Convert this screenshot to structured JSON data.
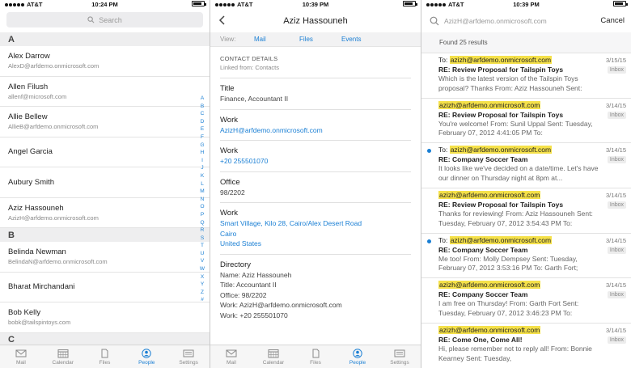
{
  "panel1": {
    "status": {
      "carrier": "AT&T",
      "time": "10:24 PM"
    },
    "search_placeholder": "Search",
    "sections": [
      {
        "letter": "A",
        "contacts": [
          {
            "name": "Alex Darrow",
            "email": "AlexD@arfdemo.onmicrosoft.com"
          },
          {
            "name": "Allen Filush",
            "email": "allenf@microsoft.com"
          },
          {
            "name": "Allie Bellew",
            "email": "AllieB@arfdemo.onmicrosoft.com"
          },
          {
            "name": "Angel Garcia",
            "email": ""
          },
          {
            "name": "Aubury Smith",
            "email": ""
          },
          {
            "name": "Aziz Hassouneh",
            "email": "AzizH@arfdemo.onmicrosoft.com"
          }
        ]
      },
      {
        "letter": "B",
        "contacts": [
          {
            "name": "Belinda Newman",
            "email": "BelindaN@arfdemo.onmicrosoft.com"
          },
          {
            "name": "Bharat Mirchandani",
            "email": ""
          },
          {
            "name": "Bob Kelly",
            "email": "bobk@tailspintoys.com"
          }
        ]
      },
      {
        "letter": "C",
        "contacts": []
      }
    ],
    "index_letters": [
      "A",
      "B",
      "C",
      "D",
      "E",
      "F",
      "G",
      "H",
      "I",
      "J",
      "K",
      "L",
      "M",
      "N",
      "O",
      "P",
      "Q",
      "R",
      "S",
      "T",
      "U",
      "V",
      "W",
      "X",
      "Y",
      "Z",
      "#"
    ],
    "active_tab": 3
  },
  "panel2": {
    "status": {
      "carrier": "AT&T",
      "time": "10:39 PM"
    },
    "title": "Aziz Hassouneh",
    "view_label": "View:",
    "view_links": [
      "Mail",
      "Files",
      "Events"
    ],
    "section_title": "CONTACT DETAILS",
    "section_sub": "Linked from: Contacts",
    "fields": {
      "title": {
        "label": "Title",
        "value": "Finance, Accountant II"
      },
      "work_email": {
        "label": "Work",
        "value": "AzizH@arfdemo.onmicrosoft.com"
      },
      "work_phone": {
        "label": "Work",
        "value": "+20 255501070"
      },
      "office": {
        "label": "Office",
        "value": "98/2202"
      },
      "work_address": {
        "label": "Work",
        "lines": [
          "Smart Village, Kilo 28, Cairo/Alex Desert Road",
          "Cairo",
          "United States"
        ]
      },
      "directory": {
        "label": "Directory",
        "lines": [
          "Name: Aziz Hassouneh",
          "Title: Accountant II",
          "Office: 98/2202",
          "Work: AzizH@arfdemo.onmicrosoft.com",
          "Work: +20 255501070"
        ]
      }
    },
    "active_tab": 3
  },
  "panel3": {
    "status": {
      "carrier": "AT&T",
      "time": "10:39 PM"
    },
    "query": "AzizH@arfdemo.onmicrosoft.com",
    "cancel_label": "Cancel",
    "found_label": "Found 25 results",
    "results": [
      {
        "prefix": "To: ",
        "address": "azizh@arfdemo.onmicrosoft.com",
        "date": "3/15/15",
        "badge": "Inbox",
        "unread": false,
        "subject": "RE: Review Proposal for Tailspin Toys",
        "preview": "Which is the latest version of the Tailspin Toys proposal? Thanks From: Aziz Hassouneh Sent:"
      },
      {
        "prefix": "",
        "address": "azizh@arfdemo.onmicrosoft.com",
        "date": "3/14/15",
        "badge": "Inbox",
        "unread": false,
        "subject": "RE: Review Proposal for Tailspin Toys",
        "preview": "You're welcome! From: Sunil Uppal Sent: Tuesday, February 07, 2012 4:41:05 PM To:"
      },
      {
        "prefix": "To: ",
        "address": "azizh@arfdemo.onmicrosoft.com",
        "date": "3/14/15",
        "badge": "Inbox",
        "unread": true,
        "subject": "RE: Company Soccer Team",
        "preview": "It looks like we've decided on a date/time. Let's have our dinner on Thursday night at 8pm at..."
      },
      {
        "prefix": "",
        "address": "azizh@arfdemo.onmicrosoft.com",
        "date": "3/14/15",
        "badge": "Inbox",
        "unread": false,
        "subject": "RE: Review Proposal for Tailspin Toys",
        "preview": "Thanks for reviewing! From: Aziz Hassouneh Sent: Tuesday, February 07, 2012 3:54:43 PM To:"
      },
      {
        "prefix": "To: ",
        "address": "azizh@arfdemo.onmicrosoft.com",
        "date": "3/14/15",
        "badge": "Inbox",
        "unread": true,
        "subject": "RE: Company Soccer Team",
        "preview": "Me too! From: Molly Dempsey Sent: Tuesday, February 07, 2012 3:53:16 PM To: Garth Fort;"
      },
      {
        "prefix": "",
        "address": "azizh@arfdemo.onmicrosoft.com",
        "date": "3/14/15",
        "badge": "Inbox",
        "unread": false,
        "subject": "RE: Company Soccer Team",
        "preview": "I am free on Thursday! From: Garth Fort Sent: Tuesday, February 07, 2012 3:46:23 PM To:"
      },
      {
        "prefix": "",
        "address": "azizh@arfdemo.onmicrosoft.com",
        "date": "3/14/15",
        "badge": "Inbox",
        "unread": false,
        "subject": "RE: Come One, Come All!",
        "preview": "Hi, please remember not to reply all! From: Bonnie Kearney Sent: Tuesday,"
      }
    ]
  },
  "tabbar": [
    {
      "label": "Mail",
      "icon": "mail-icon"
    },
    {
      "label": "Calendar",
      "icon": "calendar-icon"
    },
    {
      "label": "Files",
      "icon": "files-icon"
    },
    {
      "label": "People",
      "icon": "people-icon"
    },
    {
      "label": "Settings",
      "icon": "settings-icon"
    }
  ],
  "colors": {
    "accent": "#1a7fd4",
    "highlight": "#f5e14a"
  }
}
